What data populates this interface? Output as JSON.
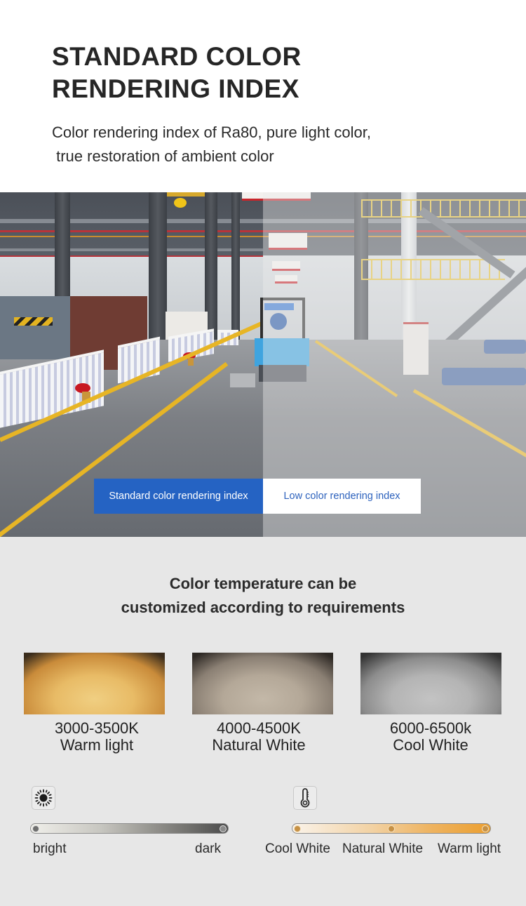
{
  "header": {
    "title_lines": [
      "STANDARD COLOR",
      "RENDERING INDEX"
    ],
    "subtitle_lines": [
      "Color rendering index of Ra80, pure light color,",
      " true restoration of ambient color"
    ]
  },
  "comparison_photo": {
    "description": "factory-floor-comparison-photo",
    "labels": {
      "standard": "Standard color rendering index",
      "low": "Low color rendering index"
    },
    "colors": {
      "standard_label_bg": "#2563c3",
      "low_label_text": "#2d62bd"
    }
  },
  "color_temperature": {
    "title_lines": [
      "Color temperature can be",
      "customized according to requirements"
    ],
    "options": [
      {
        "range": "3000-3500K",
        "name": "Warm light",
        "swatch_color": "#e8bb66"
      },
      {
        "range": "4000-4500K",
        "name": "Natural White",
        "swatch_color": "#b4a898"
      },
      {
        "range": "6000-6500k",
        "name": "Cool White",
        "swatch_color": "#b4b4b4"
      }
    ]
  },
  "brightness_scale": {
    "icon": "sun-icon",
    "start_label": "bright",
    "end_label": "dark"
  },
  "temperature_scale": {
    "icon": "thermometer-icon",
    "stops": [
      "Cool White",
      "Natural White",
      "Warm light"
    ]
  }
}
